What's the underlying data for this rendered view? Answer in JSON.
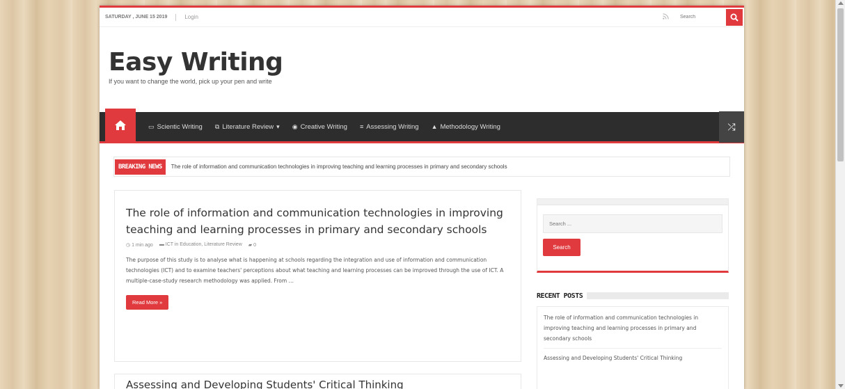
{
  "topbar": {
    "date": "Saturday , June 15 2019",
    "login": "Login",
    "search_placeholder": "Search"
  },
  "site": {
    "title": "Easy Writing",
    "tagline": "If you want to change the world, pick up your pen and write"
  },
  "nav": {
    "items": [
      {
        "label": "Scientic Writing",
        "icon": "folder-icon"
      },
      {
        "label": "Literature Review",
        "icon": "copy-icon",
        "has_dropdown": true
      },
      {
        "label": "Creative Writing",
        "icon": "eye-icon"
      },
      {
        "label": "Assessing Writing",
        "icon": "sliders-icon"
      },
      {
        "label": "Methodology Writing",
        "icon": "graduation-cap-icon"
      }
    ]
  },
  "breaking": {
    "label": "BREAKING NEWS",
    "text": "The role of information and communication technologies in improving teaching and learning processes in primary and secondary schools"
  },
  "posts": [
    {
      "title": "The role of information and communication technologies in improving teaching and learning processes in primary and secondary schools",
      "time": "1 min ago",
      "categories": "ICT in Education, Literature Review",
      "comments": "0",
      "excerpt": "The purpose of this study is to analyse what is happening at schools regarding the integration and use of information and communication technologies (ICT) and to examine teachers' perceptions about what teaching and learning processes can be improved through the use of ICT. A multiple-case-study research methodology was applied. From …",
      "read_more": "Read More »"
    },
    {
      "title": "Assessing and Developing Students' Critical Thinking"
    }
  ],
  "sidebar": {
    "search_placeholder": "Search ...",
    "search_button": "Search",
    "recent_title": "RECENT POSTS",
    "recent": [
      "The role of information and communication technologies in improving teaching and learning processes in primary and secondary schools",
      "Assessing and Developing Students' Critical Thinking"
    ]
  },
  "colors": {
    "accent": "#e03a3e",
    "nav_bg": "#2d2d2d"
  }
}
